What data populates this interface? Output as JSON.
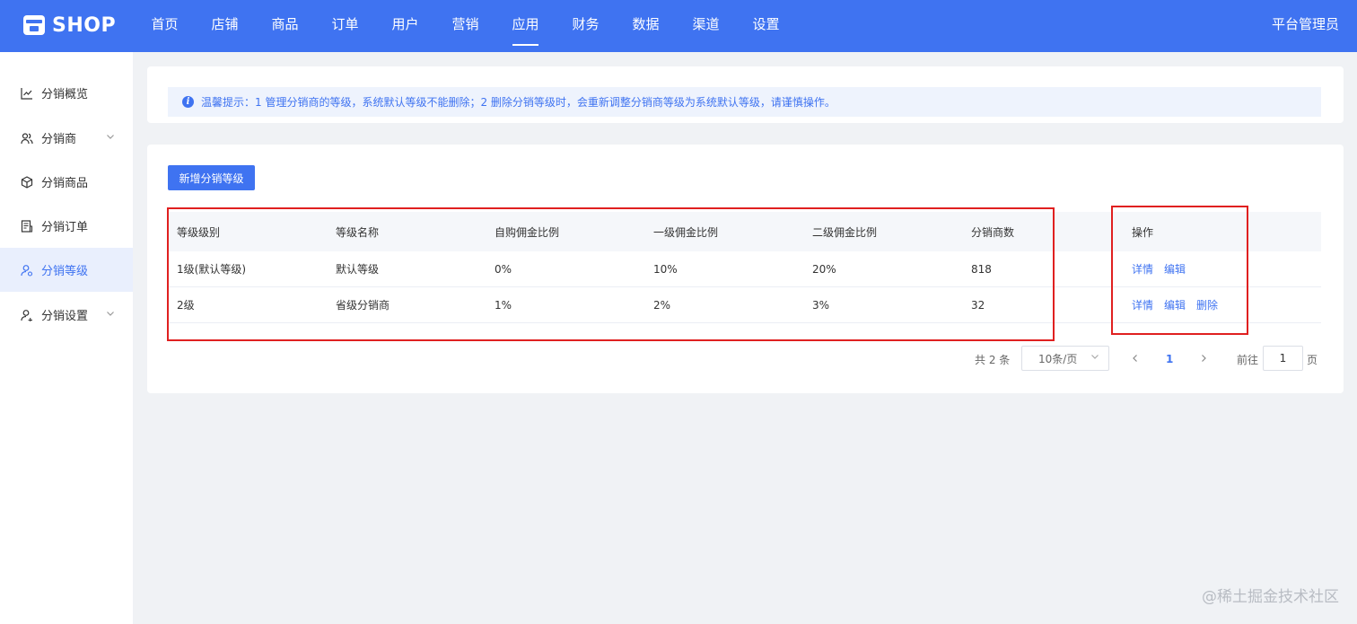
{
  "header": {
    "logo_text": "SHOP",
    "nav": [
      "首页",
      "店铺",
      "商品",
      "订单",
      "用户",
      "营销",
      "应用",
      "财务",
      "数据",
      "渠道",
      "设置"
    ],
    "active_nav": "应用",
    "admin": "平台管理员",
    "color": "#3f73f1"
  },
  "sidebar": {
    "items": [
      {
        "label": "分销概览",
        "icon": "chart-line-icon"
      },
      {
        "label": "分销商",
        "icon": "users-icon",
        "has_chevron": true
      },
      {
        "label": "分销商品",
        "icon": "box-icon"
      },
      {
        "label": "分销订单",
        "icon": "order-icon"
      },
      {
        "label": "分销等级",
        "icon": "level-user-icon",
        "active": true
      },
      {
        "label": "分销设置",
        "icon": "user-settings-icon",
        "has_chevron": true
      }
    ]
  },
  "tip": {
    "text": "温馨提示：1 管理分销商的等级，系统默认等级不能删除；2 删除分销等级时，会重新调整分销商等级为系统默认等级，请谨慎操作。"
  },
  "main": {
    "add_button": "新增分销等级",
    "table": {
      "headers": [
        "等级级别",
        "等级名称",
        "自购佣金比例",
        "一级佣金比例",
        "二级佣金比例",
        "分销商数",
        "操作"
      ],
      "rows": [
        {
          "level": "1级(默认等级)",
          "name": "默认等级",
          "self": "0%",
          "first": "10%",
          "second": "20%",
          "count": "818",
          "actions": [
            "详情",
            "编辑"
          ]
        },
        {
          "level": "2级",
          "name": "省级分销商",
          "self": "1%",
          "first": "2%",
          "second": "3%",
          "count": "32",
          "actions": [
            "详情",
            "编辑",
            "删除"
          ]
        }
      ]
    },
    "pagination": {
      "total": "共 2 条",
      "page_size": "10条/页",
      "current_page": "1",
      "goto_label": "前往",
      "goto_value": "1",
      "page_suffix": "页"
    }
  },
  "watermark": "@稀土掘金技术社区"
}
